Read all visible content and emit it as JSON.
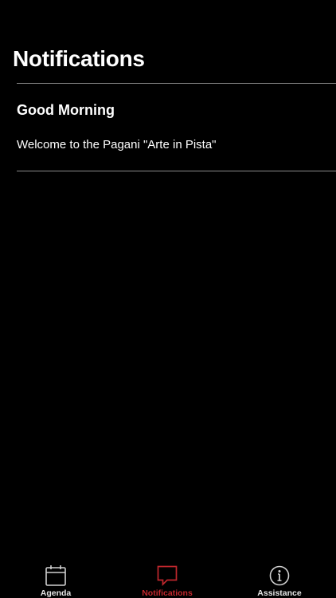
{
  "page": {
    "title": "Notifications"
  },
  "notifications": [
    {
      "title": "Good Morning",
      "body": "Welcome to the Pagani \"Arte in Pista\""
    }
  ],
  "tab_bar": {
    "active_tab": "Notifications",
    "active_color": "#c1272d",
    "inactive_color": "#e6e6e6",
    "tabs": [
      {
        "label": "Agenda",
        "icon": "calendar-icon"
      },
      {
        "label": "Notifications",
        "icon": "speech-bubble-icon"
      },
      {
        "label": "Assistance",
        "icon": "info-circle-icon"
      }
    ]
  }
}
